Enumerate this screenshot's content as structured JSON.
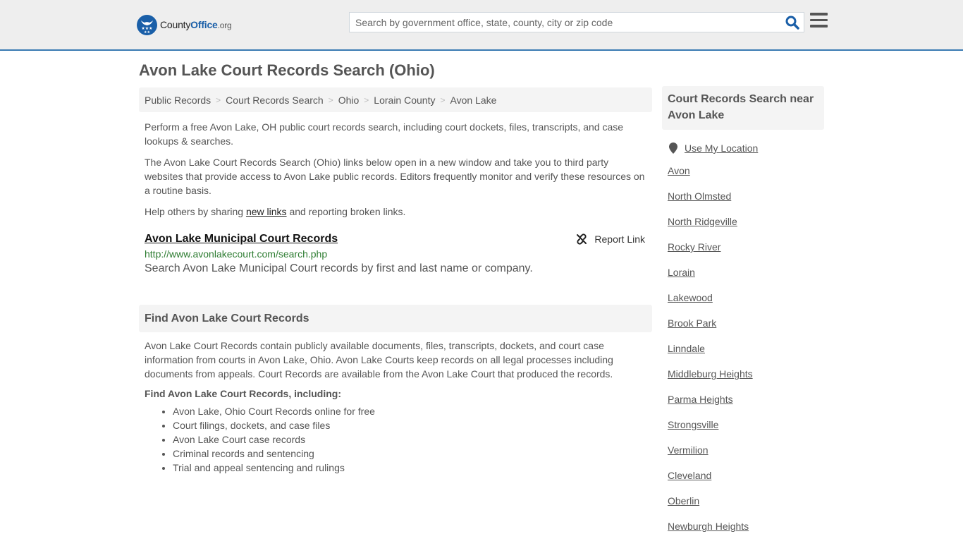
{
  "header": {
    "logo": {
      "county": "County",
      "office": "Office",
      "org": ".org",
      "icon": "eagle-stars-badge-icon"
    },
    "search": {
      "placeholder": "Search by government office, state, county, city or zip code",
      "value": "",
      "icon": "search-icon"
    },
    "menu_icon": "hamburger-menu-icon",
    "accent_color": "#3a7ab2",
    "brand_color": "#1a5fa8"
  },
  "page": {
    "title": "Avon Lake Court Records Search (Ohio)"
  },
  "breadcrumb": [
    "Public Records",
    "Court Records Search",
    "Ohio",
    "Lorain County",
    "Avon Lake"
  ],
  "intro": {
    "p1": "Perform a free Avon Lake, OH public court records search, including court dockets, files, transcripts, and case lookups & searches.",
    "p2": "The Avon Lake Court Records Search (Ohio) links below open in a new window and take you to third party websites that provide access to Avon Lake public records. Editors frequently monitor and verify these resources on a routine basis.",
    "p3_before": "Help others by sharing ",
    "p3_link": "new links",
    "p3_after": " and reporting broken links."
  },
  "results": [
    {
      "title": "Avon Lake Municipal Court Records",
      "url": "http://www.avonlakecourt.com/search.php",
      "description": "Search Avon Lake Municipal Court records by first and last name or company.",
      "report_label": "Report Link",
      "report_icon": "broken-link-icon"
    }
  ],
  "find_section": {
    "heading": "Find Avon Lake Court Records",
    "paragraph": "Avon Lake Court Records contain publicly available documents, files, transcripts, dockets, and court case information from courts in Avon Lake, Ohio. Avon Lake Courts keep records on all legal processes including documents from appeals. Court Records are available from the Avon Lake Court that produced the records.",
    "subheading": "Find Avon Lake Court Records, including:",
    "items": [
      "Avon Lake, Ohio Court Records online for free",
      "Court filings, dockets, and case files",
      "Avon Lake Court case records",
      "Criminal records and sentencing",
      "Trial and appeal sentencing and rulings"
    ]
  },
  "sidebar": {
    "heading": "Court Records Search near Avon Lake",
    "use_location": "Use My Location",
    "location_icon": "map-pin-icon",
    "nearby": [
      "Avon",
      "North Olmsted",
      "North Ridgeville",
      "Rocky River",
      "Lorain",
      "Lakewood",
      "Brook Park",
      "Linndale",
      "Middleburg Heights",
      "Parma Heights",
      "Strongsville",
      "Vermilion",
      "Cleveland",
      "Oberlin",
      "Newburgh Heights"
    ]
  }
}
